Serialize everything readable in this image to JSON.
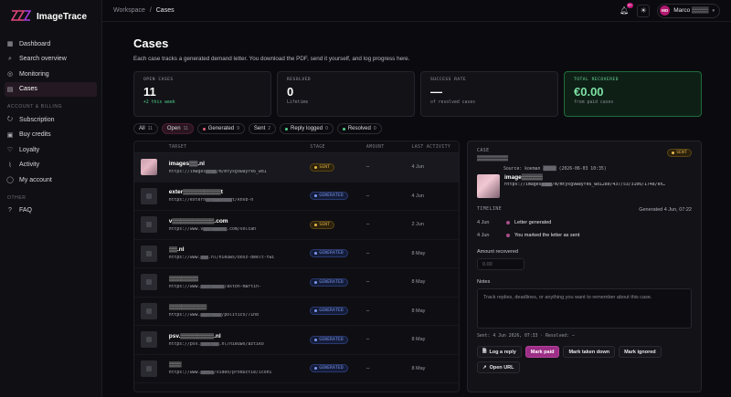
{
  "app": {
    "name": "ImageTrace"
  },
  "sidebar": {
    "primary": [
      {
        "label": "Dashboard",
        "icon": "dashboard-icon"
      },
      {
        "label": "Search overview",
        "icon": "search-icon"
      },
      {
        "label": "Monitoring",
        "icon": "monitor-icon"
      },
      {
        "label": "Cases",
        "icon": "folder-icon",
        "active": true
      }
    ],
    "section_account": "Account & Billing",
    "account": [
      {
        "label": "Subscription",
        "icon": "subscription-icon"
      },
      {
        "label": "Buy credits",
        "icon": "credits-icon"
      },
      {
        "label": "Loyalty",
        "icon": "heart-icon"
      },
      {
        "label": "Activity",
        "icon": "activity-icon"
      },
      {
        "label": "My account",
        "icon": "user-icon"
      }
    ],
    "section_other": "Other",
    "other": [
      {
        "label": "FAQ",
        "icon": "help-icon"
      }
    ]
  },
  "topbar": {
    "crumb_root": "Workspace",
    "crumb_sep": "/",
    "crumb_current": "Cases",
    "notif_count": "9+",
    "user_initials": "MO",
    "user_name": "Marco ▒▒▒▒"
  },
  "page": {
    "title": "Cases",
    "subtitle": "Each case tracks a generated demand letter. You download the PDF, send it yourself, and log progress here."
  },
  "stats": [
    {
      "label": "OPEN CASES",
      "value": "11",
      "foot": "+2 this week"
    },
    {
      "label": "RESOLVED",
      "value": "0",
      "foot": "Lifetime"
    },
    {
      "label": "SUCCESS RATE",
      "value": "—",
      "foot": "of resolved cases"
    },
    {
      "label": "TOTAL RECOVERED",
      "value": "€0.00",
      "foot": "from paid cases"
    }
  ],
  "filters": [
    {
      "label": "All",
      "count": "11",
      "dot": ""
    },
    {
      "label": "Open",
      "count": "11",
      "dot": ""
    },
    {
      "label": "Generated",
      "count": "9",
      "dot": "#e0607a"
    },
    {
      "label": "Sent",
      "count": "2",
      "dot": ""
    },
    {
      "label": "Reply logged",
      "count": "0",
      "dot": "#4fd18a"
    },
    {
      "label": "Resolved",
      "count": "0",
      "dot": "#4fd18a"
    }
  ],
  "table": {
    "headers": {
      "target": "TARGET",
      "stage": "STAGE",
      "amount": "AMOUNT",
      "last": "LAST ACTIVITY"
    },
    "rows": [
      {
        "name": "images▒▒.nl",
        "url": "https://images▒▒▒▒/m/mtyxg9wayfk6_wd1",
        "stage": "SENT",
        "amount": "–",
        "last": "4 Jun",
        "thumb": "pink"
      },
      {
        "name": "exter▒▒▒▒▒▒▒▒▒t",
        "url": "https://extern▒▒▒▒▒▒▒▒▒▒t/knvb-h",
        "stage": "GENERATED",
        "amount": "–",
        "last": "4 Jun",
        "thumb": "grey"
      },
      {
        "name": "v▒▒▒▒▒▒▒▒▒▒.com",
        "url": "https://www.v▒▒▒▒▒▒▒▒▒.com/volcan",
        "stage": "SENT",
        "amount": "–",
        "last": "2 Jun",
        "thumb": "grey"
      },
      {
        "name": "▒▒.nl",
        "url": "https://www.▒▒▒.nl/nieuws/bosz-deelt-twi",
        "stage": "GENERATED",
        "amount": "–",
        "last": "8 May",
        "thumb": "grey"
      },
      {
        "name": "▒▒▒▒▒▒▒",
        "url": "https://www.▒▒▒▒▒▒▒▒▒/aston-martin-",
        "stage": "GENERATED",
        "amount": "–",
        "last": "8 May",
        "thumb": "grey"
      },
      {
        "name": "▒▒▒▒▒▒▒▒▒",
        "url": "https://www.▒▒▒▒▒▒▒▒/politics/71nd",
        "stage": "GENERATED",
        "amount": "–",
        "last": "8 May",
        "thumb": "grey"
      },
      {
        "name": "psv.▒▒▒▒▒▒▒▒.nl",
        "url": "https://psv.▒▒▒▒▒▒▒.nl/nieuws/aztiko",
        "stage": "GENERATED",
        "amount": "–",
        "last": "8 May",
        "thumb": "grey"
      },
      {
        "name": "▒▒▒",
        "url": "https://www.▒▒▒▒▒/video/productie/iconi",
        "stage": "GENERATED",
        "amount": "–",
        "last": "8 May",
        "thumb": "grey"
      }
    ]
  },
  "detail": {
    "label": "CASE",
    "case_name": "▒▒▒▒▒▒▒▒",
    "stage": "SENT",
    "source": "Source: koeman ▒▒▒▒▒ (2026-06-03 10:35)",
    "title": "image▒▒▒▒▒",
    "url": "https://images▒▒▒▒/m/mtyxg9wayfk6_wd1280/437/53/3106/1748/kn…",
    "timeline_label": "TIMELINE",
    "timeline_generated": "Generated 4 Jun, 07:22",
    "timeline": [
      {
        "date": "4 Jun",
        "text": "Letter generated"
      },
      {
        "date": "4 Jun",
        "text": "You marked the letter as sent"
      }
    ],
    "amount_label": "Amount recovered",
    "amount_placeholder": "0.00",
    "notes_label": "Notes",
    "notes_placeholder": "Track replies, deadlines, or anything you want to remember about this case.",
    "sent_line": "Sent: 4 Jun 2026, 07:33 · Resolved: –",
    "actions": {
      "log_reply": "Log a reply",
      "mark_paid": "Mark paid",
      "mark_taken_down": "Mark taken down",
      "mark_ignored": "Mark ignored",
      "open_url": "Open URL"
    }
  },
  "colors": {
    "accent": "#c2177a",
    "sent": "#e8b84a",
    "generated": "#7f9cf5",
    "success": "#4fd18a"
  }
}
